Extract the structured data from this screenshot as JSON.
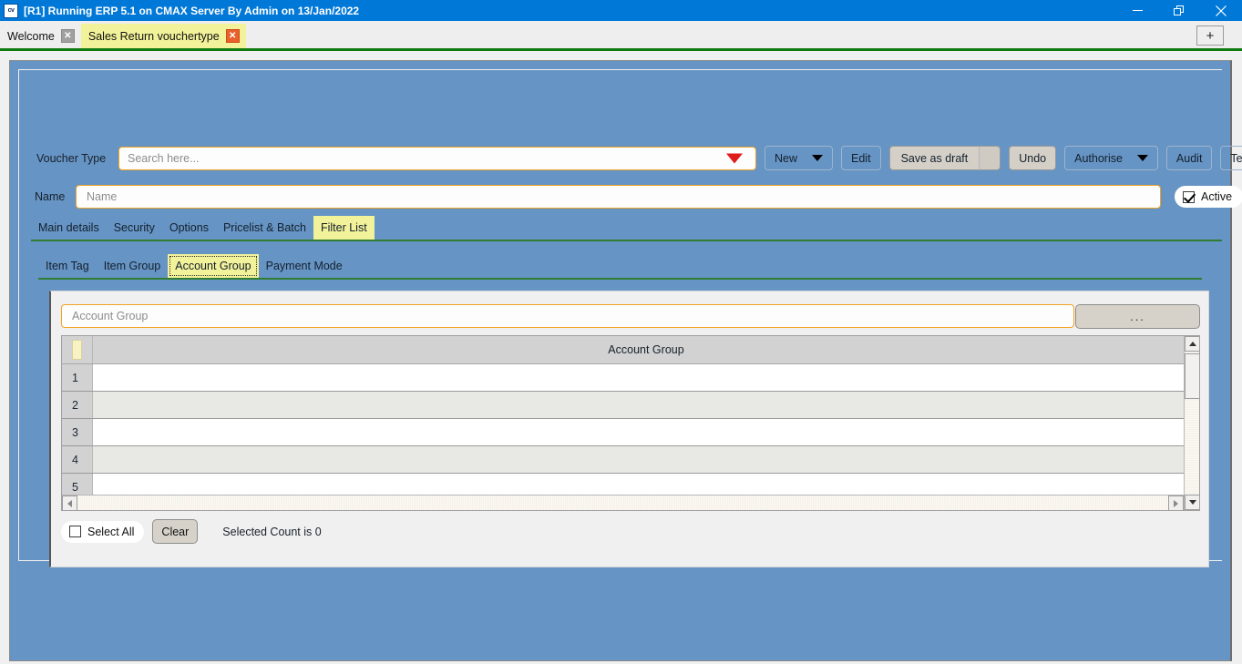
{
  "window": {
    "title": "[R1] Running ERP 5.1 on CMAX Server By Admin on 13/Jan/2022",
    "app_icon_text": "cv",
    "minimize_label": "—",
    "restore_label": "❐",
    "close_label": "✕"
  },
  "tabstrip": {
    "tabs": [
      {
        "label": "Welcome",
        "close_label": "✕",
        "active": false
      },
      {
        "label": "Sales Return vouchertype",
        "close_label": "✕",
        "active": true
      }
    ],
    "add_tab_label": "+"
  },
  "form": {
    "voucher_type_label": "Voucher Type",
    "voucher_type_placeholder": "Search here...",
    "name_label": "Name",
    "name_placeholder": "Name",
    "active_label": "Active",
    "active_checked": true
  },
  "toolbar": {
    "new_label": "New",
    "edit_label": "Edit",
    "save_as_draft_label": "Save as draft",
    "undo_label": "Undo",
    "authorise_label": "Authorise",
    "audit_label": "Audit",
    "template_label": "Template"
  },
  "primary_tabs": [
    {
      "label": "Main details",
      "active": false
    },
    {
      "label": "Security",
      "active": false
    },
    {
      "label": "Options",
      "active": false
    },
    {
      "label": "Pricelist & Batch",
      "active": false
    },
    {
      "label": "Filter List",
      "active": true
    }
  ],
  "secondary_tabs": [
    {
      "label": "Item Tag",
      "active": false
    },
    {
      "label": "Item Group",
      "active": false
    },
    {
      "label": "Account Group",
      "active": true
    },
    {
      "label": "Payment Mode",
      "active": false
    }
  ],
  "panel": {
    "account_group_placeholder": "Account Group",
    "browse_label": "...",
    "grid": {
      "column_header": "Account Group",
      "rows": [
        {
          "number": "1",
          "value": ""
        },
        {
          "number": "2",
          "value": ""
        },
        {
          "number": "3",
          "value": ""
        },
        {
          "number": "4",
          "value": ""
        },
        {
          "number": "5",
          "value": ""
        }
      ]
    },
    "select_all_label": "Select All",
    "select_all_checked": false,
    "clear_label": "Clear",
    "selected_count_text": "Selected Count is 0"
  },
  "colors": {
    "titlebar": "#0078d7",
    "panel_blue": "#6694c4",
    "accent_orange": "#f0a323",
    "tab_active_yellow": "#f2f29a",
    "green_rule": "#0f7a0f",
    "dropdown_red": "#e01b1b"
  }
}
